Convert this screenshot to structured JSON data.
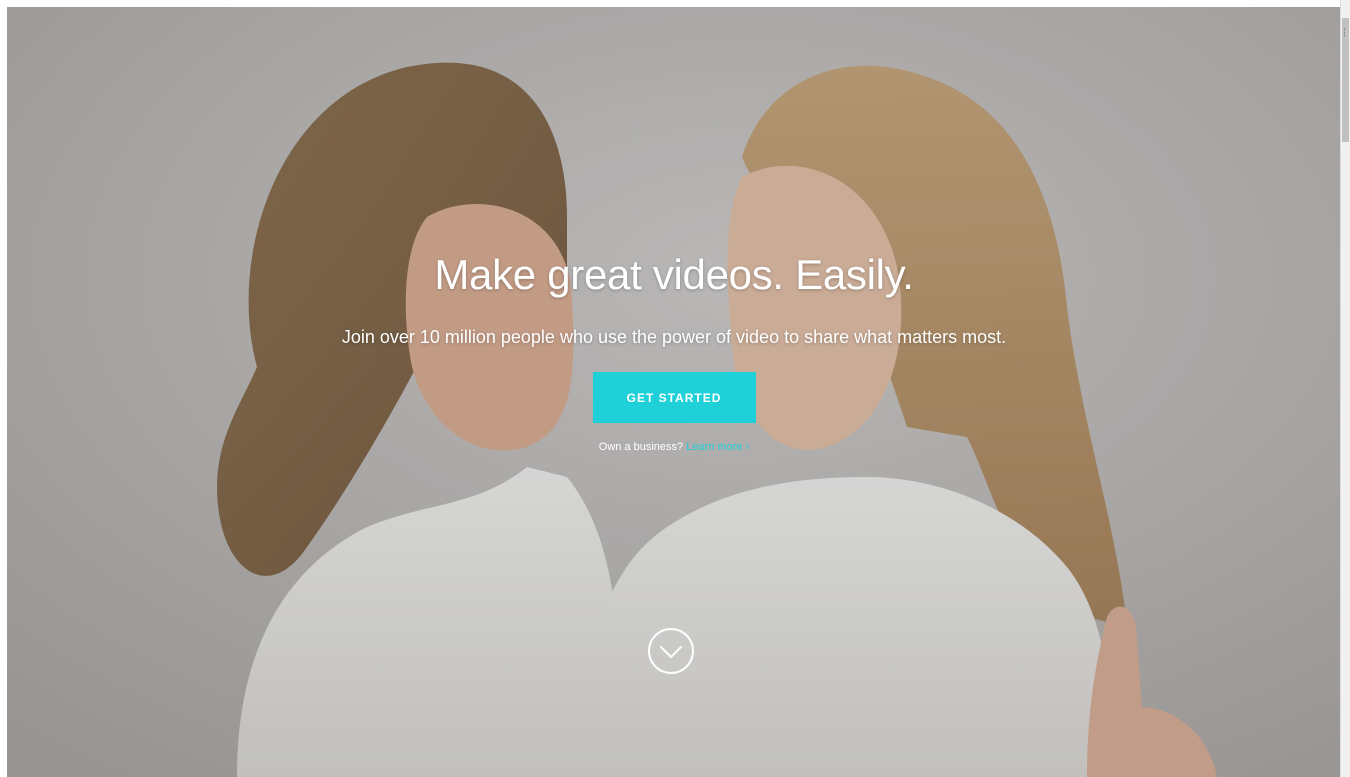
{
  "hero": {
    "title": "Make great videos. Easily.",
    "subtitle": "Join over 10 million people who use the power of video to share what matters most.",
    "cta_label": "GET STARTED",
    "business_prompt": "Own a business?",
    "business_link": "Learn more ›",
    "background_image": "mother-and-daughter-photo",
    "scroll_icon": "chevron-down-circle-icon"
  },
  "colors": {
    "accent": "#1fd0d9",
    "text": "#ffffff"
  }
}
